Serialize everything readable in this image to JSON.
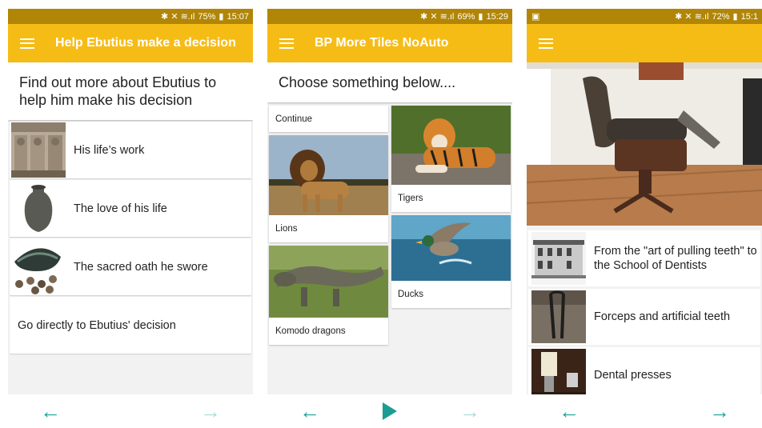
{
  "screens": [
    {
      "status": {
        "left": "",
        "battery": "75%",
        "time": "15:07",
        "icons": "✱ ✕ ≋.ıl"
      },
      "title": "Help Ebutius make a decision",
      "header": "Find out more about Ebutius to help him make his decision",
      "items": [
        {
          "label": "His life’s work",
          "icon": "relief-sculpture-image"
        },
        {
          "label": "The love of his life",
          "icon": "vase-image"
        },
        {
          "label": "The sacred oath he swore",
          "icon": "coins-bowl-image"
        },
        {
          "label": "Go directly to Ebutius' decision"
        }
      ],
      "nav": {
        "back": "←",
        "forward": "→"
      }
    },
    {
      "status": {
        "left": "",
        "battery": "69%",
        "time": "15:29",
        "icons": "✱ ✕ ≋.ıl"
      },
      "title": "BP More Tiles NoAuto",
      "header": "Choose something below....",
      "tiles": {
        "continue": "Continue",
        "lions": "Lions",
        "tigers": "Tigers",
        "komodo": "Komodo dragons",
        "ducks": "Ducks"
      },
      "nav": {
        "back": "←",
        "forward": "→"
      }
    },
    {
      "status": {
        "left": "▣",
        "battery": "72%",
        "time": "15:1",
        "icons": "✱ ✕ ≋.ıl"
      },
      "title": "",
      "items": [
        {
          "label": "From the \"art of pulling teeth\" to the School of Dentists",
          "icon": "building-image"
        },
        {
          "label": "Forceps and artificial teeth",
          "icon": "forceps-image"
        },
        {
          "label": "Dental presses",
          "icon": "dental-press-image"
        }
      ],
      "nav": {
        "back": "←",
        "forward": "→"
      }
    }
  ],
  "colors": {
    "appbar": "#f6bc16",
    "statusbar": "#b18606",
    "accent": "#1aa39a"
  }
}
